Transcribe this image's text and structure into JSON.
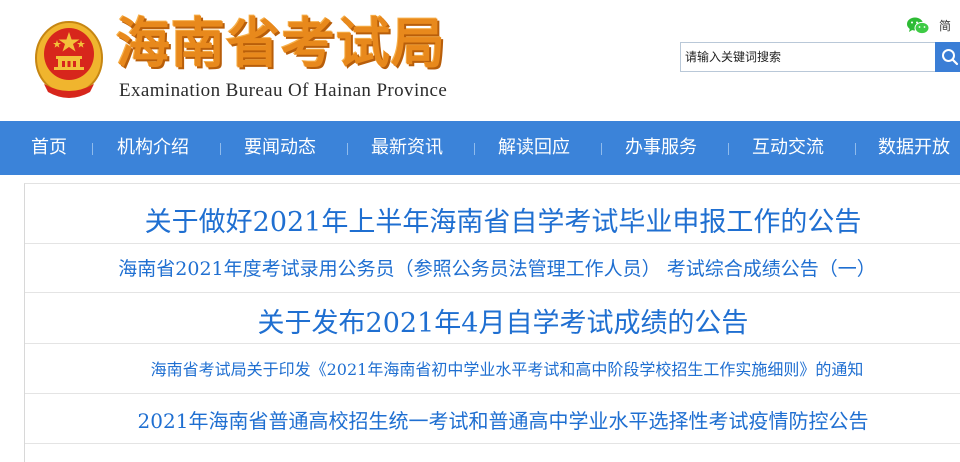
{
  "header": {
    "site_title_cn": "海南省考试局",
    "site_title_en": "Examination Bureau Of Hainan Province",
    "lang_link": "简",
    "search_placeholder": "请输入关键词搜索"
  },
  "nav": {
    "items": [
      {
        "label": "首页"
      },
      {
        "label": "机构介绍"
      },
      {
        "label": "要闻动态"
      },
      {
        "label": "最新资讯"
      },
      {
        "label": "解读回应"
      },
      {
        "label": "办事服务"
      },
      {
        "label": "互动交流"
      },
      {
        "label": "数据开放"
      }
    ]
  },
  "headlines": [
    {
      "title": "关于做好2021年上半年海南省自学考试毕业申报工作的公告"
    },
    {
      "title": "海南省2021年度考试录用公务员（参照公务员法管理工作人员） 考试综合成绩公告（一）"
    },
    {
      "title": "关于发布2021年4月自学考试成绩的公告"
    },
    {
      "title": "海南省考试局关于印发《2021年海南省初中学业水平考试和高中阶段学校招生工作实施细则》的通知"
    },
    {
      "title": "2021年海南省普通高校招生统一考试和普通高中学业水平选择性考试疫情防控公告"
    }
  ],
  "colors": {
    "nav_bg": "#3b83d9",
    "headline": "#1f6fd1",
    "logo_orange": "#e8891c",
    "emblem_red": "#d7261c",
    "emblem_gold": "#f3c13a"
  },
  "icons": {
    "emblem": "national-emblem-icon",
    "wechat": "wechat-icon",
    "search": "search-icon"
  }
}
